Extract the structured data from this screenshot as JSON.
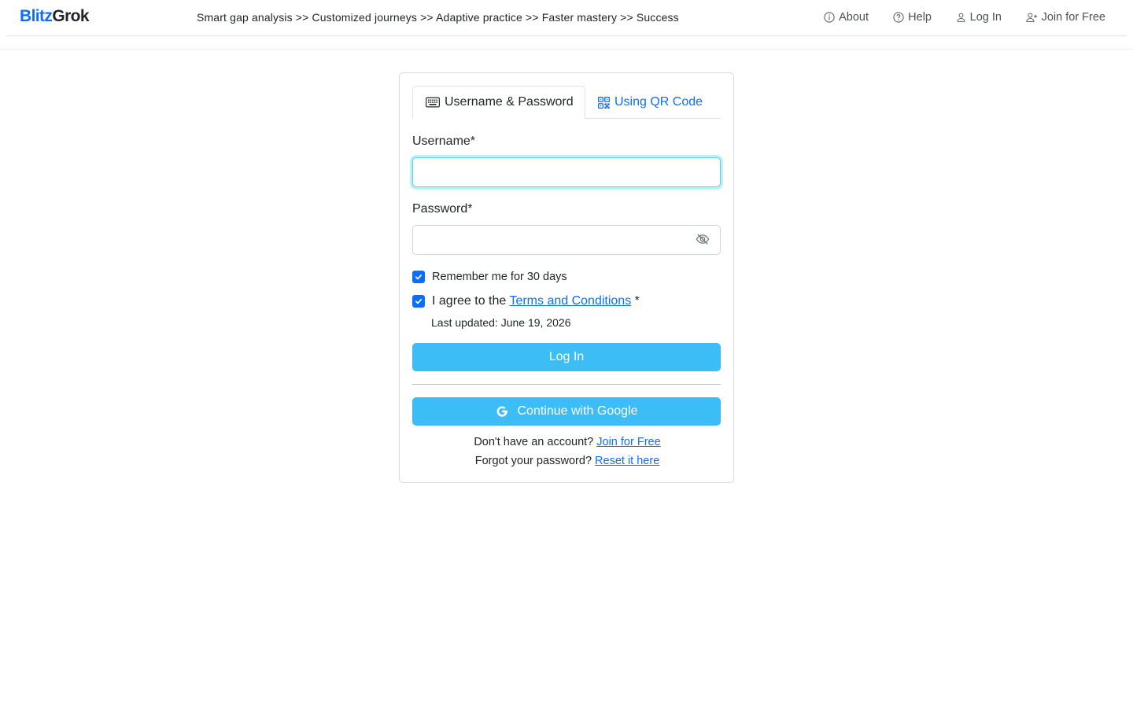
{
  "brand": {
    "part1": "Blitz",
    "part2": "Grok"
  },
  "header": {
    "tagline": "Smart gap analysis >> Customized journeys >> Adaptive practice >> Faster mastery >> Success",
    "nav": {
      "about": "About",
      "help": "Help",
      "login": "Log In",
      "join": "Join for Free"
    }
  },
  "login": {
    "tabs": {
      "password_tab": "Username & Password",
      "qr_tab": "Using QR Code"
    },
    "username": {
      "label": "Username*",
      "value": "",
      "placeholder": ""
    },
    "password": {
      "label": "Password*",
      "value": "",
      "placeholder": ""
    },
    "remember": {
      "label": "Remember me for 30 days",
      "checked": true
    },
    "terms": {
      "prefix": "I agree to the ",
      "link": "Terms and Conditions",
      "suffix": " *",
      "checked": true,
      "updated": "Last updated: June 19, 2026"
    },
    "login_button": "Log In",
    "google_button": "Continue with Google",
    "signup": {
      "text": "Don't have an account? ",
      "link": "Join for Free"
    },
    "forgot": {
      "text": "Forgot your password? ",
      "link": "Reset it here"
    }
  },
  "colors": {
    "brand_blue": "#0d6efd",
    "button_blue": "#3dbdf6",
    "focus_ring": "#5ecbf0"
  },
  "icons": {
    "about": "info-circle-icon",
    "help": "question-circle-icon",
    "login": "person-icon",
    "join": "person-plus-icon",
    "password_tab": "keyboard-icon",
    "qr_tab": "qr-code-icon",
    "password_toggle": "eye-slash-icon",
    "google": "google-icon"
  }
}
